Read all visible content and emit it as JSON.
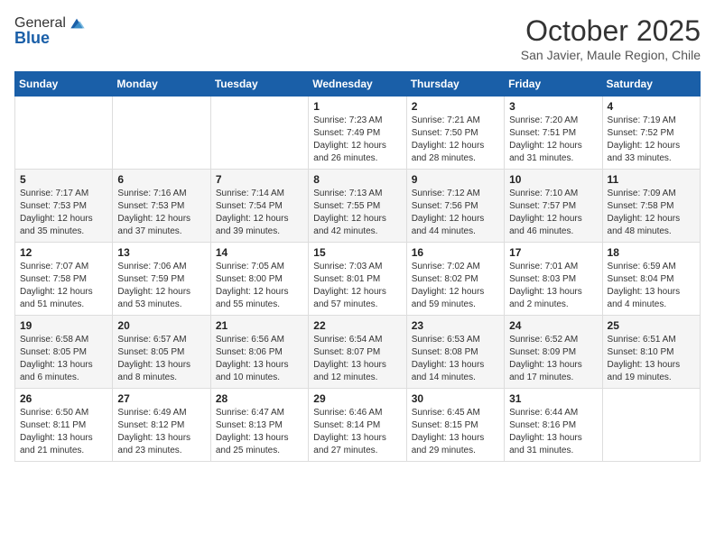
{
  "header": {
    "logo_line1": "General",
    "logo_line2": "Blue",
    "month_year": "October 2025",
    "location": "San Javier, Maule Region, Chile"
  },
  "days_of_week": [
    "Sunday",
    "Monday",
    "Tuesday",
    "Wednesday",
    "Thursday",
    "Friday",
    "Saturday"
  ],
  "weeks": [
    [
      {
        "day": "",
        "info": ""
      },
      {
        "day": "",
        "info": ""
      },
      {
        "day": "",
        "info": ""
      },
      {
        "day": "1",
        "info": "Sunrise: 7:23 AM\nSunset: 7:49 PM\nDaylight: 12 hours and 26 minutes."
      },
      {
        "day": "2",
        "info": "Sunrise: 7:21 AM\nSunset: 7:50 PM\nDaylight: 12 hours and 28 minutes."
      },
      {
        "day": "3",
        "info": "Sunrise: 7:20 AM\nSunset: 7:51 PM\nDaylight: 12 hours and 31 minutes."
      },
      {
        "day": "4",
        "info": "Sunrise: 7:19 AM\nSunset: 7:52 PM\nDaylight: 12 hours and 33 minutes."
      }
    ],
    [
      {
        "day": "5",
        "info": "Sunrise: 7:17 AM\nSunset: 7:53 PM\nDaylight: 12 hours and 35 minutes."
      },
      {
        "day": "6",
        "info": "Sunrise: 7:16 AM\nSunset: 7:53 PM\nDaylight: 12 hours and 37 minutes."
      },
      {
        "day": "7",
        "info": "Sunrise: 7:14 AM\nSunset: 7:54 PM\nDaylight: 12 hours and 39 minutes."
      },
      {
        "day": "8",
        "info": "Sunrise: 7:13 AM\nSunset: 7:55 PM\nDaylight: 12 hours and 42 minutes."
      },
      {
        "day": "9",
        "info": "Sunrise: 7:12 AM\nSunset: 7:56 PM\nDaylight: 12 hours and 44 minutes."
      },
      {
        "day": "10",
        "info": "Sunrise: 7:10 AM\nSunset: 7:57 PM\nDaylight: 12 hours and 46 minutes."
      },
      {
        "day": "11",
        "info": "Sunrise: 7:09 AM\nSunset: 7:58 PM\nDaylight: 12 hours and 48 minutes."
      }
    ],
    [
      {
        "day": "12",
        "info": "Sunrise: 7:07 AM\nSunset: 7:58 PM\nDaylight: 12 hours and 51 minutes."
      },
      {
        "day": "13",
        "info": "Sunrise: 7:06 AM\nSunset: 7:59 PM\nDaylight: 12 hours and 53 minutes."
      },
      {
        "day": "14",
        "info": "Sunrise: 7:05 AM\nSunset: 8:00 PM\nDaylight: 12 hours and 55 minutes."
      },
      {
        "day": "15",
        "info": "Sunrise: 7:03 AM\nSunset: 8:01 PM\nDaylight: 12 hours and 57 minutes."
      },
      {
        "day": "16",
        "info": "Sunrise: 7:02 AM\nSunset: 8:02 PM\nDaylight: 12 hours and 59 minutes."
      },
      {
        "day": "17",
        "info": "Sunrise: 7:01 AM\nSunset: 8:03 PM\nDaylight: 13 hours and 2 minutes."
      },
      {
        "day": "18",
        "info": "Sunrise: 6:59 AM\nSunset: 8:04 PM\nDaylight: 13 hours and 4 minutes."
      }
    ],
    [
      {
        "day": "19",
        "info": "Sunrise: 6:58 AM\nSunset: 8:05 PM\nDaylight: 13 hours and 6 minutes."
      },
      {
        "day": "20",
        "info": "Sunrise: 6:57 AM\nSunset: 8:05 PM\nDaylight: 13 hours and 8 minutes."
      },
      {
        "day": "21",
        "info": "Sunrise: 6:56 AM\nSunset: 8:06 PM\nDaylight: 13 hours and 10 minutes."
      },
      {
        "day": "22",
        "info": "Sunrise: 6:54 AM\nSunset: 8:07 PM\nDaylight: 13 hours and 12 minutes."
      },
      {
        "day": "23",
        "info": "Sunrise: 6:53 AM\nSunset: 8:08 PM\nDaylight: 13 hours and 14 minutes."
      },
      {
        "day": "24",
        "info": "Sunrise: 6:52 AM\nSunset: 8:09 PM\nDaylight: 13 hours and 17 minutes."
      },
      {
        "day": "25",
        "info": "Sunrise: 6:51 AM\nSunset: 8:10 PM\nDaylight: 13 hours and 19 minutes."
      }
    ],
    [
      {
        "day": "26",
        "info": "Sunrise: 6:50 AM\nSunset: 8:11 PM\nDaylight: 13 hours and 21 minutes."
      },
      {
        "day": "27",
        "info": "Sunrise: 6:49 AM\nSunset: 8:12 PM\nDaylight: 13 hours and 23 minutes."
      },
      {
        "day": "28",
        "info": "Sunrise: 6:47 AM\nSunset: 8:13 PM\nDaylight: 13 hours and 25 minutes."
      },
      {
        "day": "29",
        "info": "Sunrise: 6:46 AM\nSunset: 8:14 PM\nDaylight: 13 hours and 27 minutes."
      },
      {
        "day": "30",
        "info": "Sunrise: 6:45 AM\nSunset: 8:15 PM\nDaylight: 13 hours and 29 minutes."
      },
      {
        "day": "31",
        "info": "Sunrise: 6:44 AM\nSunset: 8:16 PM\nDaylight: 13 hours and 31 minutes."
      },
      {
        "day": "",
        "info": ""
      }
    ]
  ]
}
